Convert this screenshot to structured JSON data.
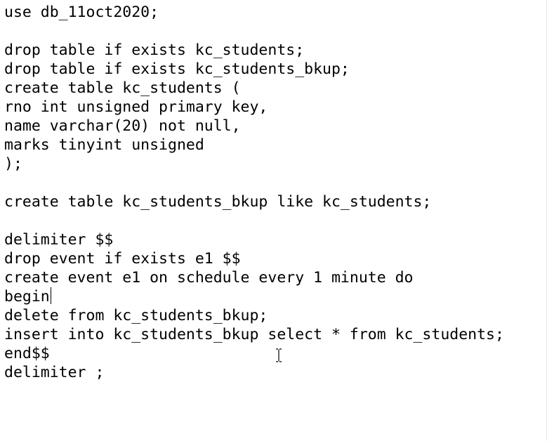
{
  "editor": {
    "lines": [
      "use db_11oct2020;",
      "",
      "drop table if exists kc_students;",
      "drop table if exists kc_students_bkup;",
      "create table kc_students (",
      "rno int unsigned primary key,",
      "name varchar(20) not null,",
      "marks tinyint unsigned",
      ");",
      "",
      "create table kc_students_bkup like kc_students;",
      "",
      "delimiter $$",
      "drop event if exists e1 $$",
      "create event e1 on schedule every 1 minute do",
      "begin",
      "delete from kc_students_bkup;",
      "insert into kc_students_bkup select * from kc_students;",
      "end$$",
      "delimiter ;"
    ],
    "caret_line_index": 15,
    "mouse_cursor_icon": "text-ibeam-cursor"
  }
}
